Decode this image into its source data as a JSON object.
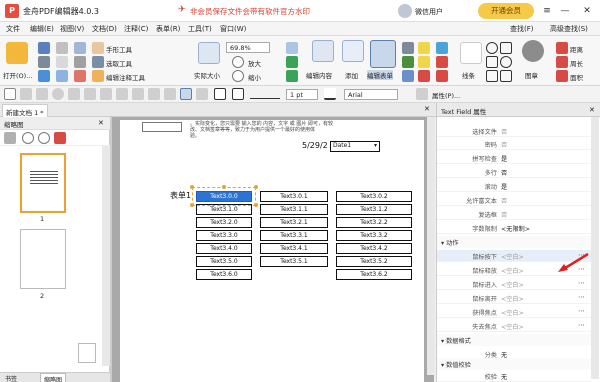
{
  "app": {
    "title": "金舟PDF编辑器4.0.3",
    "ad_text": "非会员保存文件会带有软件官方水印",
    "user_name": "微信用户",
    "vip_button": "开通会员"
  },
  "menu": {
    "items": [
      "文件",
      "编辑(E)",
      "视图(V)",
      "文档(D)",
      "注释(C)",
      "表单(R)",
      "工具(T)",
      "窗口(W)"
    ],
    "right": [
      "查找(F)",
      "高级查找(S)"
    ]
  },
  "toolbar": {
    "open": "打开(O)...",
    "hand": "手形工具",
    "select_text": "选取工具",
    "edit_annot": "编辑注释工具",
    "actual_size": "实际大小",
    "zoom_value": "69.8%",
    "zoom_in": "放大",
    "zoom_out": "缩小",
    "edit_content": "编辑内容",
    "add": "添加",
    "edit_form": "编辑表单",
    "line": "线条",
    "image": "图章",
    "distance": "距离",
    "perimeter": "周长",
    "area": "面积"
  },
  "toolbar2": {
    "stroke_width": "1 pt",
    "font": "Arial",
    "props_label": "属性(P)..."
  },
  "tabs": {
    "doc_tab": "新建文档 1 *",
    "thumb_title": "缩略图",
    "bottom_tab_1": "书签",
    "bottom_tab_2": "缩略图"
  },
  "thumbnails": [
    {
      "num": "1"
    },
    {
      "num": "2"
    }
  ],
  "document": {
    "header_text_1": "。实际变化，您只需要 输入您的 内容，文字 或 图片 即可，有较",
    "header_text_2": "改、文档签章等等，致力于为用户提供一个最好的使用体",
    "header_text_3": "验。",
    "date_value": "5/29/2",
    "date_field": "Date1",
    "form_label": "表单1",
    "fields_col1": [
      "Text3.0.0",
      "Text3.1.0",
      "Text3.2.0",
      "Text3.3.0",
      "Text3.4.0",
      "Text3.5.0",
      "Text3.6.0"
    ],
    "fields_col2": [
      "Text3.0.1",
      "Text3.1.1",
      "Text3.2.1",
      "Text3.3.1",
      "Text3.4.1",
      "Text3.5.1"
    ],
    "fields_col3": [
      "Text3.0.2",
      "Text3.1.2",
      "Text3.2.2",
      "Text3.3.2",
      "Text3.4.2",
      "Text3.5.2",
      "Text3.6.2"
    ]
  },
  "properties": {
    "title": "Text Field 属性",
    "rows": [
      {
        "k": "选择文件",
        "v": "否"
      },
      {
        "k": "密码",
        "v": "否"
      },
      {
        "k": "拼写检查",
        "v": "是"
      },
      {
        "k": "多行",
        "v": "否"
      },
      {
        "k": "滚动",
        "v": "是"
      },
      {
        "k": "允许富文本",
        "v": "否"
      },
      {
        "k": "复选框",
        "v": "否"
      },
      {
        "k": "字数限制",
        "v": "<无限制>"
      }
    ],
    "section_actions": "动作",
    "action_rows": [
      {
        "k": "鼠标按下",
        "v": "<空白>"
      },
      {
        "k": "鼠标释放",
        "v": "<空白>"
      },
      {
        "k": "鼠标进入",
        "v": "<空白>"
      },
      {
        "k": "鼠标离开",
        "v": "<空白>"
      },
      {
        "k": "获得焦点",
        "v": "<空白>"
      },
      {
        "k": "失去焦点",
        "v": "<空白>"
      }
    ],
    "section_format": "数据格式",
    "format_row": {
      "k": "分类",
      "v": "无"
    },
    "section_validate": "数值校验",
    "validate_row": {
      "k": "校验",
      "v": "无"
    }
  }
}
